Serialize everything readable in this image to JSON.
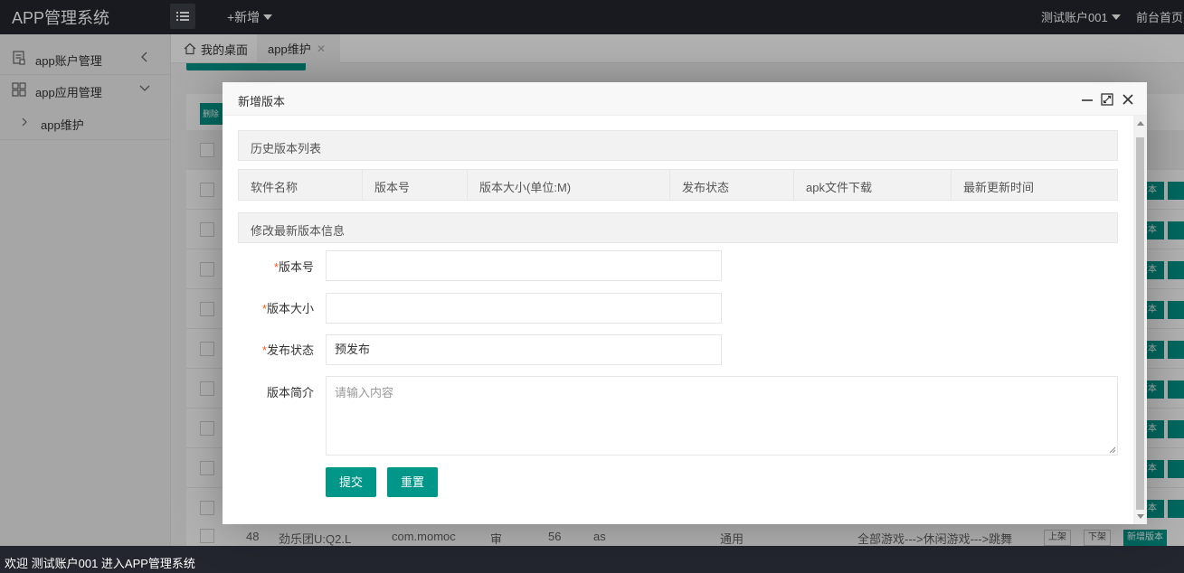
{
  "header": {
    "app_title": "APP管理系统",
    "menu_toggle_icon": "list-icon",
    "add_label": "+新增",
    "account_label": "测试账户001",
    "frontpage_label": "前台首页"
  },
  "sidebar": {
    "items": [
      {
        "label": "app账户管理",
        "icon": "doc-icon",
        "arrow": "chevron-left-icon"
      },
      {
        "label": "app应用管理",
        "icon": "grid-icon",
        "arrow": "chevron-down-icon"
      },
      {
        "label": "app维护",
        "icon": "chevron-right-icon"
      }
    ]
  },
  "tabs": {
    "home_label": "我的桌面",
    "active_label": "app维护",
    "close_glyph": "✕"
  },
  "background_table": {
    "row_button_label": "版本",
    "last_row": {
      "id": "48",
      "name": "劲乐团U:Q2.L",
      "package": "com.momoc",
      "status": "审",
      "size": "56",
      "platform": "as",
      "category_general": "通用",
      "categories": "全部游戏--->休闲游戏--->跳舞",
      "btn_up": "上架",
      "btn_down": "下架",
      "btn_new_version": "新增版本"
    },
    "delete_label": "删除"
  },
  "dialog": {
    "title": "新增版本",
    "history_section": "历史版本列表",
    "history_columns": [
      "软件名称",
      "版本号",
      "版本大小(单位:M)",
      "发布状态",
      "apk文件下载",
      "最新更新时间"
    ],
    "edit_section": "修改最新版本信息",
    "form": {
      "version_label": "版本号",
      "version_value": "",
      "size_label": "版本大小",
      "size_value": "",
      "publish_label": "发布状态",
      "publish_value": "预发布",
      "intro_label": "版本简介",
      "intro_placeholder": "请输入内容",
      "required_mark": "*"
    },
    "submit_label": "提交",
    "reset_label": "重置"
  },
  "footer": {
    "welcome_text": "欢迎 测试账户001 进入APP管理系统"
  },
  "colors": {
    "header_bg": "#23262e",
    "accent": "#009688",
    "required": "#ff5722"
  }
}
